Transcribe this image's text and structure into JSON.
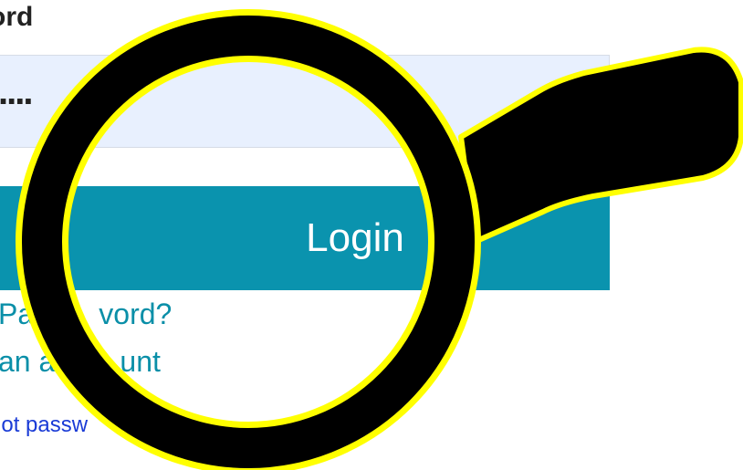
{
  "form": {
    "password_label": "ord",
    "password_value": "....",
    "login_label": "Login",
    "forgot_link": "Pa        vord?",
    "create_link": "an a        unt",
    "forgot_small_link": "got passw"
  },
  "overlay": {
    "icon": "magnifying-glass-icon",
    "ring_color": "#ffff00",
    "lens_color": "#000000"
  },
  "colors": {
    "button_bg": "#0a93ae",
    "input_bg": "#e8f0fe",
    "link": "#0a8fa8",
    "small_link": "#1a3bd6"
  }
}
